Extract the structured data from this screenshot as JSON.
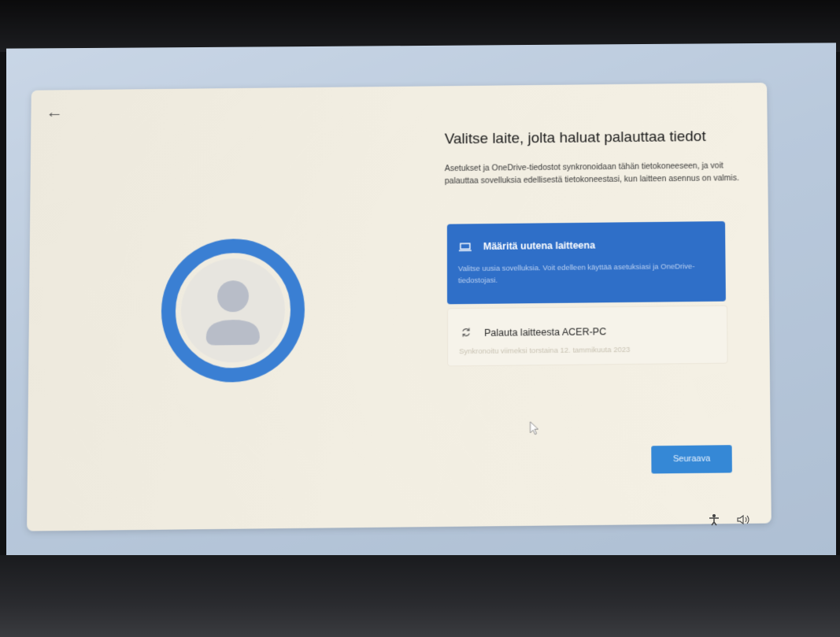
{
  "page": {
    "title": "Valitse laite, jolta haluat palauttaa tiedot",
    "description": "Asetukset ja OneDrive-tiedostot synkronoidaan tähän tietokoneeseen, ja voit palauttaa sovelluksia edellisestä tietokoneestasi, kun laitteen asennus on valmis."
  },
  "options": {
    "new_device": {
      "label": "Määritä uutena laitteena",
      "sub": "Valitse uusia sovelluksia. Voit edelleen käyttää asetuksiasi ja OneDrive-tiedostojasi.",
      "icon": "laptop-icon"
    },
    "restore": {
      "label": "Palauta laitteesta ACER-PC",
      "sub": "Synkronoitu viimeksi torstaina 12. tammikuuta 2023",
      "icon": "sync-icon"
    }
  },
  "buttons": {
    "next": "Seuraava",
    "back_icon": "back-arrow-icon"
  },
  "colors": {
    "accent": "#2f6fc8",
    "next_button": "#3588d6",
    "panel": "#f2eee2"
  },
  "tray": {
    "icons": [
      "accessibility-icon",
      "volume-icon"
    ]
  }
}
